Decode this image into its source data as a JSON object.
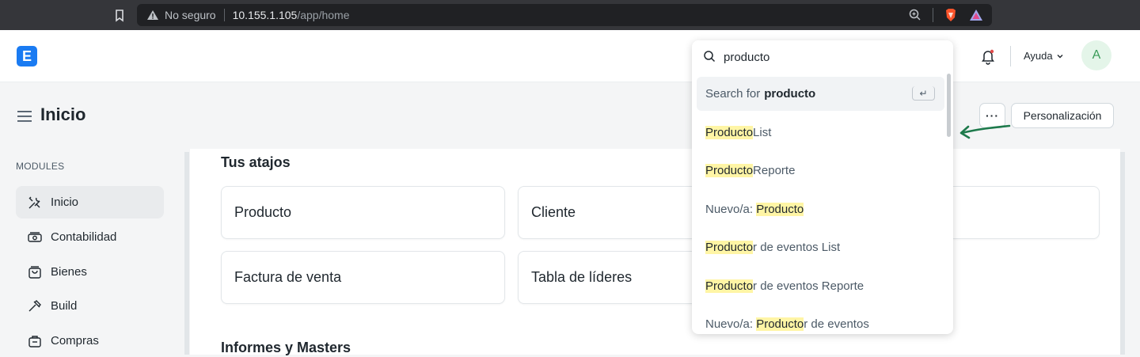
{
  "browser": {
    "security_label": "No seguro",
    "url_host": "10.155.1.105",
    "url_path": "/app/home"
  },
  "navbar": {
    "logo_letter": "E",
    "help_label": "Ayuda",
    "avatar_letter": "A"
  },
  "page": {
    "title": "Inicio",
    "more_label": "···",
    "customize_label": "Personalización"
  },
  "sidebar": {
    "heading": "MODULES",
    "items": [
      {
        "label": "Inicio",
        "icon": "tools-icon"
      },
      {
        "label": "Contabilidad",
        "icon": "money-icon"
      },
      {
        "label": "Bienes",
        "icon": "box-icon"
      },
      {
        "label": "Build",
        "icon": "hammer-icon"
      },
      {
        "label": "Compras",
        "icon": "cart-icon"
      }
    ]
  },
  "main": {
    "shortcuts_title": "Tus atajos",
    "shortcuts": [
      "Producto",
      "Cliente",
      "Factura de venta",
      "Tabla de líderes"
    ],
    "reports_title": "Informes y Masters"
  },
  "search": {
    "query": "producto",
    "first_prefix": "Search for",
    "first_bold": "producto",
    "enter_symbol": "↵",
    "results": [
      {
        "pre": "",
        "hl": "Producto",
        "post": " List"
      },
      {
        "pre": "",
        "hl": "Producto",
        "post": " Reporte"
      },
      {
        "pre": "Nuevo/a: ",
        "hl": "Producto",
        "post": ""
      },
      {
        "pre": "",
        "hl": "Producto",
        "post": "r de eventos List"
      },
      {
        "pre": "",
        "hl": "Producto",
        "post": "r de eventos Reporte"
      },
      {
        "pre": "Nuevo/a: ",
        "hl": "Producto",
        "post": "r de eventos"
      }
    ]
  },
  "colors": {
    "accent": "#1a7bf2",
    "highlight": "#fff5a5",
    "annotation": "#1e7a4c"
  }
}
